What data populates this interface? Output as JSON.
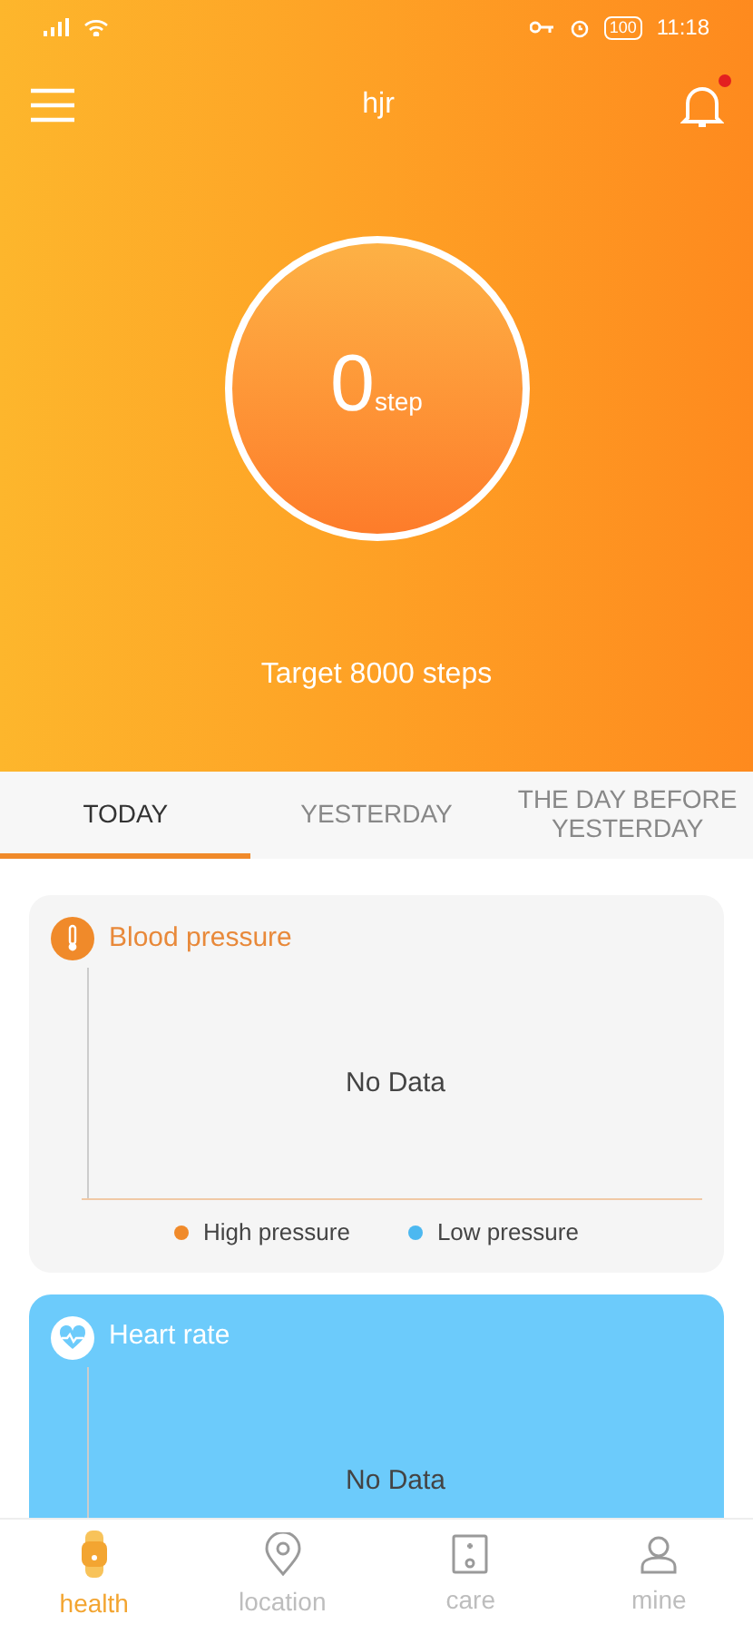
{
  "status_bar": {
    "battery": "100",
    "time": "11:18"
  },
  "header": {
    "title": "hjr",
    "notification_unread": true
  },
  "steps": {
    "count": "0",
    "unit": "step",
    "target": "Target 8000 steps"
  },
  "tabs": [
    {
      "label": "TODAY",
      "selected": true
    },
    {
      "label": "YESTERDAY",
      "selected": false
    },
    {
      "label": "THE DAY BEFORE YESTERDAY",
      "selected": false
    }
  ],
  "cards": [
    {
      "kind": "blood",
      "title": "Blood pressure",
      "empty_text": "No Data",
      "legend": [
        {
          "label": "High pressure",
          "color": "#f08a2a"
        },
        {
          "label": "Low pressure",
          "color": "#4cb8f0"
        }
      ]
    },
    {
      "kind": "heart",
      "title": "Heart rate",
      "empty_text": "No Data"
    }
  ],
  "bottom_nav": [
    {
      "kind": "health",
      "label": "health",
      "selected": true
    },
    {
      "kind": "location",
      "label": "location",
      "selected": false
    },
    {
      "kind": "care",
      "label": "care",
      "selected": false
    },
    {
      "kind": "mine",
      "label": "mine",
      "selected": false
    }
  ]
}
